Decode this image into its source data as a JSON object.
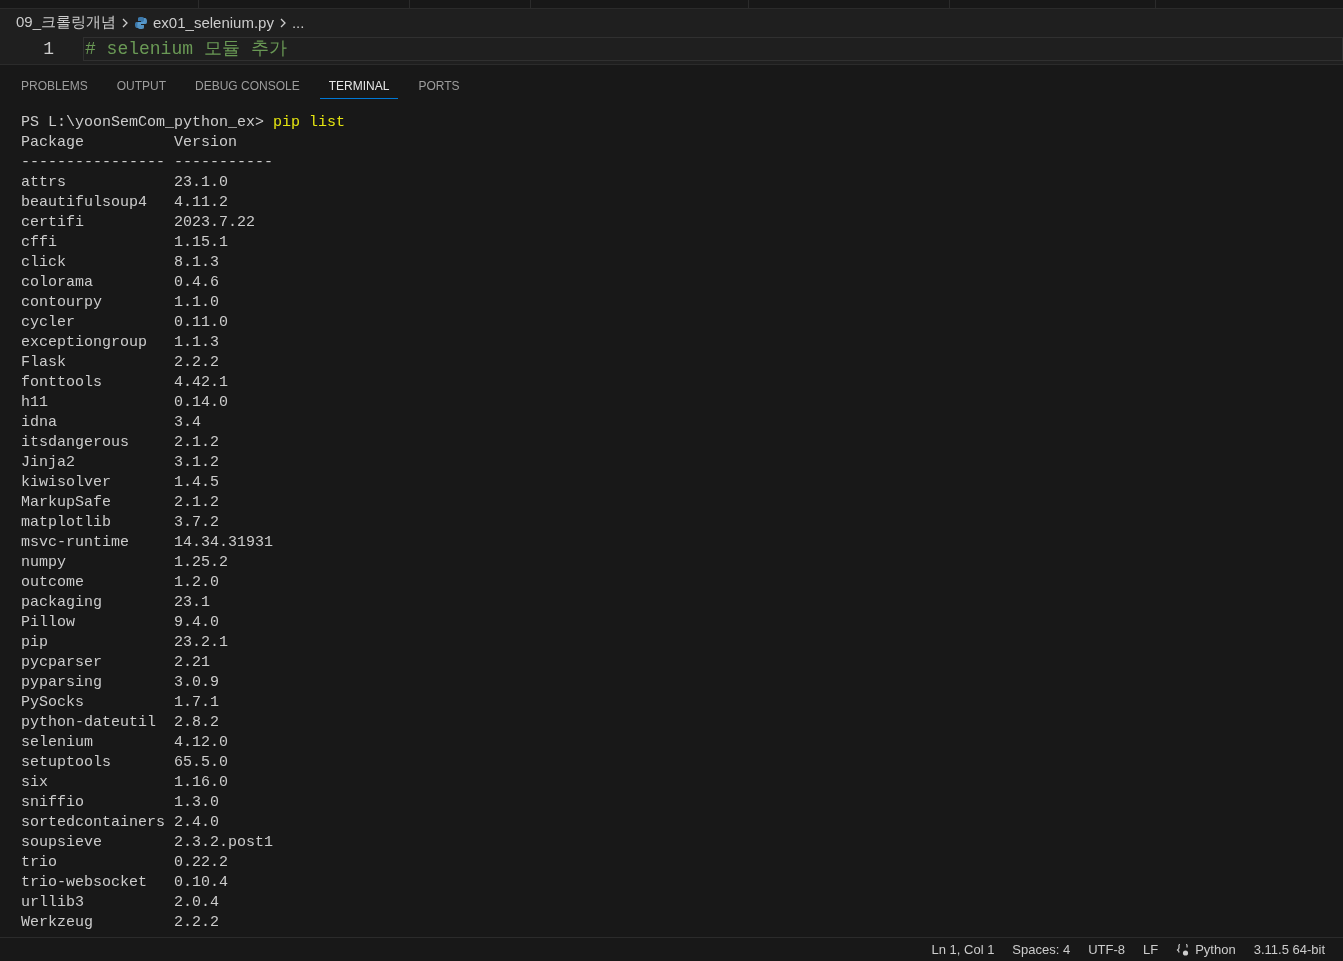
{
  "breadcrumb": {
    "folder": "09_크롤링개념",
    "file": "ex01_selenium.py",
    "more": "..."
  },
  "editor": {
    "lines": [
      {
        "number": "1",
        "text": "# selenium 모듈 추가"
      }
    ]
  },
  "panel": {
    "tabs": [
      {
        "label": "PROBLEMS",
        "selected": false
      },
      {
        "label": "OUTPUT",
        "selected": false
      },
      {
        "label": "DEBUG CONSOLE",
        "selected": false
      },
      {
        "label": "TERMINAL",
        "selected": true
      },
      {
        "label": "PORTS",
        "selected": false
      }
    ]
  },
  "terminal": {
    "prompt": "PS L:\\yoonSemCom_python_ex>",
    "command": "pip list",
    "columns": [
      "Package",
      "Version"
    ],
    "rules": [
      "----------------",
      "-----------"
    ],
    "rows": [
      {
        "package": "attrs",
        "version": "23.1.0"
      },
      {
        "package": "beautifulsoup4",
        "version": "4.11.2"
      },
      {
        "package": "certifi",
        "version": "2023.7.22"
      },
      {
        "package": "cffi",
        "version": "1.15.1"
      },
      {
        "package": "click",
        "version": "8.1.3"
      },
      {
        "package": "colorama",
        "version": "0.4.6"
      },
      {
        "package": "contourpy",
        "version": "1.1.0"
      },
      {
        "package": "cycler",
        "version": "0.11.0"
      },
      {
        "package": "exceptiongroup",
        "version": "1.1.3"
      },
      {
        "package": "Flask",
        "version": "2.2.2"
      },
      {
        "package": "fonttools",
        "version": "4.42.1"
      },
      {
        "package": "h11",
        "version": "0.14.0"
      },
      {
        "package": "idna",
        "version": "3.4"
      },
      {
        "package": "itsdangerous",
        "version": "2.1.2"
      },
      {
        "package": "Jinja2",
        "version": "3.1.2"
      },
      {
        "package": "kiwisolver",
        "version": "1.4.5"
      },
      {
        "package": "MarkupSafe",
        "version": "2.1.2"
      },
      {
        "package": "matplotlib",
        "version": "3.7.2"
      },
      {
        "package": "msvc-runtime",
        "version": "14.34.31931"
      },
      {
        "package": "numpy",
        "version": "1.25.2"
      },
      {
        "package": "outcome",
        "version": "1.2.0"
      },
      {
        "package": "packaging",
        "version": "23.1"
      },
      {
        "package": "Pillow",
        "version": "9.4.0"
      },
      {
        "package": "pip",
        "version": "23.2.1"
      },
      {
        "package": "pycparser",
        "version": "2.21"
      },
      {
        "package": "pyparsing",
        "version": "3.0.9"
      },
      {
        "package": "PySocks",
        "version": "1.7.1"
      },
      {
        "package": "python-dateutil",
        "version": "2.8.2"
      },
      {
        "package": "selenium",
        "version": "4.12.0"
      },
      {
        "package": "setuptools",
        "version": "65.5.0"
      },
      {
        "package": "six",
        "version": "1.16.0"
      },
      {
        "package": "sniffio",
        "version": "1.3.0"
      },
      {
        "package": "sortedcontainers",
        "version": "2.4.0"
      },
      {
        "package": "soupsieve",
        "version": "2.3.2.post1"
      },
      {
        "package": "trio",
        "version": "0.22.2"
      },
      {
        "package": "trio-websocket",
        "version": "0.10.4"
      },
      {
        "package": "urllib3",
        "version": "2.0.4"
      },
      {
        "package": "Werkzeug",
        "version": "2.2.2"
      }
    ]
  },
  "status_bar": [
    {
      "text": "Ln 1, Col 1",
      "kind": "plain"
    },
    {
      "text": "Spaces: 4",
      "kind": "plain"
    },
    {
      "text": "UTF-8",
      "kind": "plain"
    },
    {
      "text": "LF",
      "kind": "plain"
    },
    {
      "text": "Python",
      "kind": "language"
    },
    {
      "text": "3.11.5 64-bit",
      "kind": "plain"
    }
  ]
}
